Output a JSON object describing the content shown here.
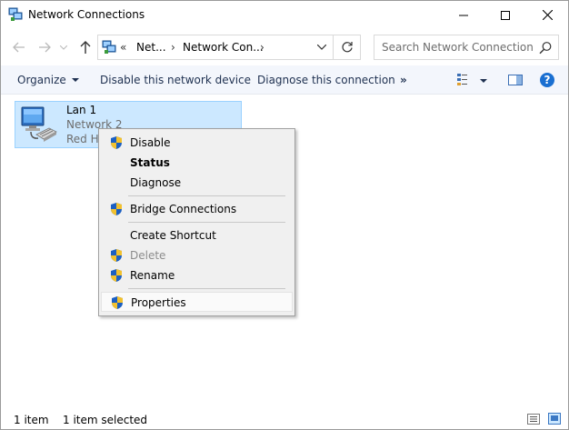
{
  "window": {
    "title": "Network Connections"
  },
  "address": {
    "overflow_chevrons": "«",
    "segments": [
      "Net...",
      "Network Con..."
    ],
    "search_placeholder": "Search Network Connections"
  },
  "commands": {
    "organize": "Organize",
    "disable_device": "Disable this network device",
    "diagnose": "Diagnose this connection",
    "more": "»"
  },
  "connection": {
    "name": "Lan 1",
    "network": "Network 2",
    "adapter": "Red Hat VirtIO Ethernet Adapter"
  },
  "context_menu": {
    "items": [
      {
        "label": "Disable",
        "shield": true
      },
      {
        "label": "Status",
        "bold": true
      },
      {
        "label": "Diagnose"
      },
      {
        "label": "Bridge Connections",
        "shield": true
      },
      {
        "label": "Create Shortcut"
      },
      {
        "label": "Delete",
        "shield": true,
        "disabled": true
      },
      {
        "label": "Rename",
        "shield": true
      },
      {
        "label": "Properties",
        "shield": true,
        "highlighted": true
      }
    ]
  },
  "status": {
    "count": "1 item",
    "selected": "1 item selected"
  },
  "colors": {
    "selection_bg": "#cce8ff",
    "selection_border": "#99d1ff",
    "command_bar_bg": "#f3f6fc",
    "help_blue": "#1a6fd1"
  }
}
